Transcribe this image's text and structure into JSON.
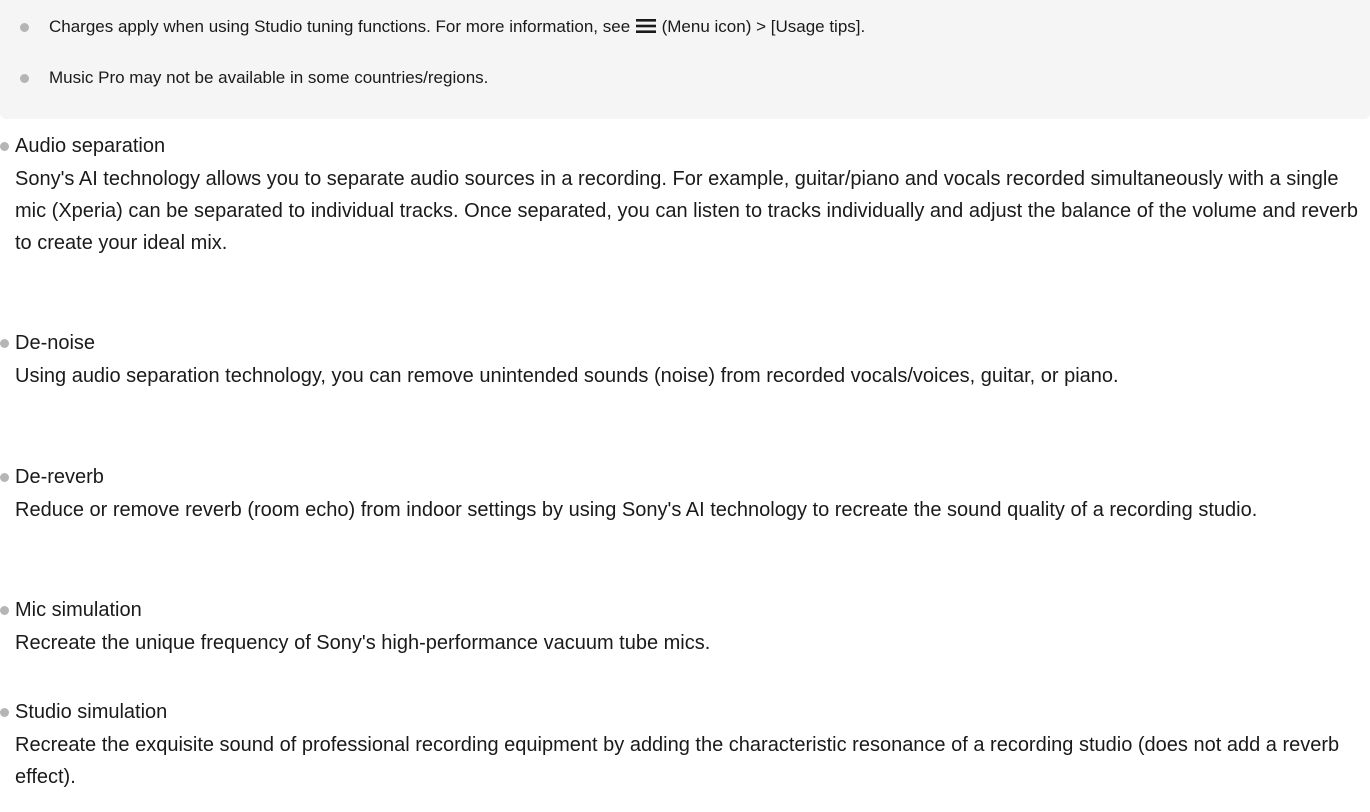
{
  "notes": [
    {
      "before_icon": "Charges apply when using Studio tuning functions. For more information, see ",
      "icon": "menu-icon",
      "after_icon": " (Menu icon) > [Usage tips]."
    },
    {
      "text": "Music Pro may not be available in some countries/regions."
    }
  ],
  "features": [
    {
      "title": "Audio separation",
      "description": "Sony's AI technology allows you to separate audio sources in a recording. For example, guitar/piano and vocals recorded simultaneously with a single mic (Xperia) can be separated to individual tracks. Once separated, you can listen to tracks individually and adjust the balance of the volume and reverb to create your ideal mix."
    },
    {
      "title": "De-noise",
      "description": "Using audio separation technology, you can remove unintended sounds (noise) from recorded vocals/voices, guitar, or piano."
    },
    {
      "title": "De-reverb",
      "description": "Reduce or remove reverb (room echo) from indoor settings by using Sony's AI technology to recreate the sound quality of a recording studio."
    },
    {
      "title": "Mic simulation",
      "description": "Recreate the unique frequency of Sony's high-performance vacuum tube mics."
    },
    {
      "title": "Studio simulation",
      "description": "Recreate the exquisite sound of professional recording equipment by adding the characteristic resonance of a recording studio (does not add a reverb effect)."
    }
  ],
  "colors": {
    "note_background": "#f5f5f5",
    "bullet": "#b5b5b5",
    "text": "#1a1a1a"
  }
}
